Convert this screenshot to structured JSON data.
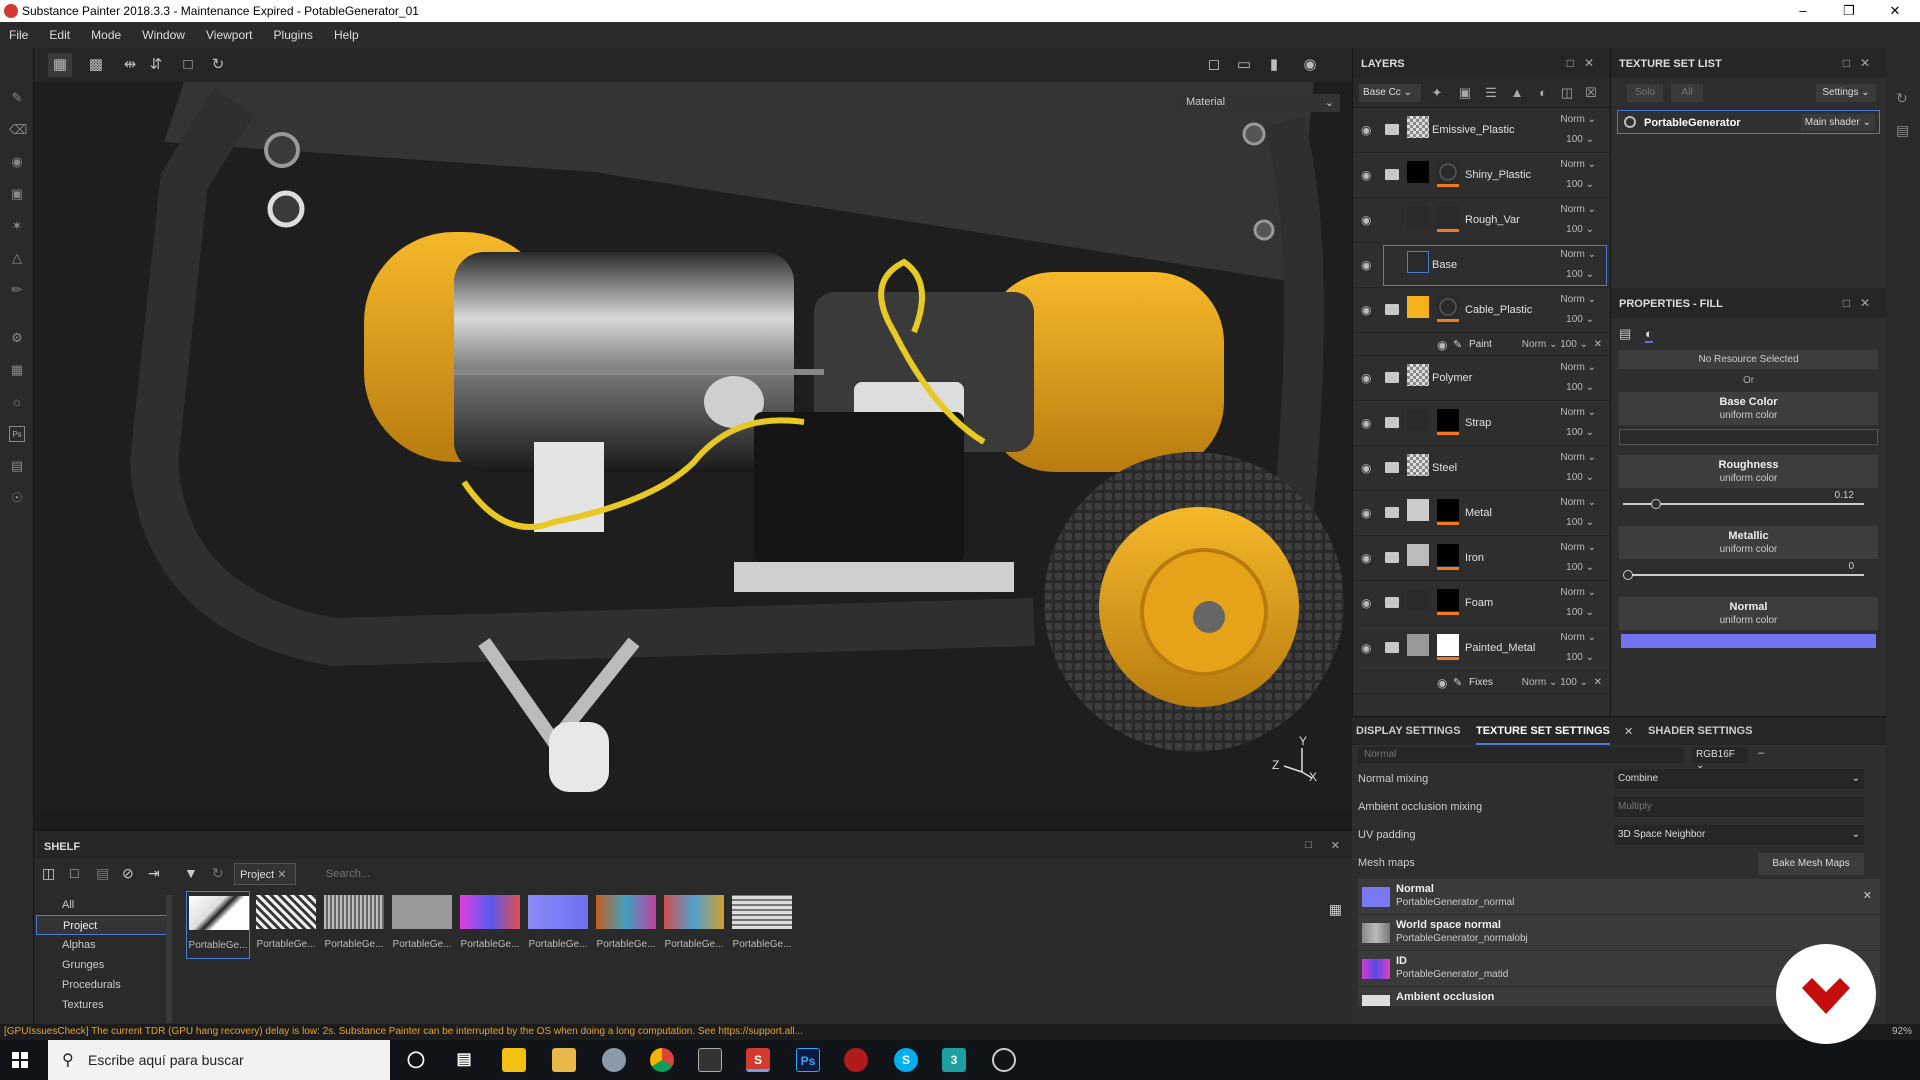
{
  "window": {
    "title": "Substance Painter 2018.3.3 - Maintenance Expired - PotableGenerator_01"
  },
  "menu": [
    "File",
    "Edit",
    "Mode",
    "Window",
    "Viewport",
    "Plugins",
    "Help"
  ],
  "viewport": {
    "material_label": "Material",
    "axes": {
      "y": "Y",
      "z": "Z",
      "x": "X"
    }
  },
  "layers": {
    "title": "LAYERS",
    "channel": "Base Cc",
    "items": [
      {
        "name": "Emissive_Plastic",
        "blend": "Norm",
        "opacity": "100"
      },
      {
        "name": "Shiny_Plastic",
        "blend": "Norm",
        "opacity": "100"
      },
      {
        "name": "Rough_Var",
        "blend": "Norm",
        "opacity": "100"
      },
      {
        "name": "Base",
        "blend": "Norm",
        "opacity": "100"
      },
      {
        "name": "Cable_Plastic",
        "blend": "Norm",
        "opacity": "100"
      },
      {
        "name": "Polymer",
        "blend": "Norm",
        "opacity": "100"
      },
      {
        "name": "Strap",
        "blend": "Norm",
        "opacity": "100"
      },
      {
        "name": "Steel",
        "blend": "Norm",
        "opacity": "100"
      },
      {
        "name": "Metal",
        "blend": "Norm",
        "opacity": "100"
      },
      {
        "name": "Iron",
        "blend": "Norm",
        "opacity": "100"
      },
      {
        "name": "Foam",
        "blend": "Norm",
        "opacity": "100"
      },
      {
        "name": "Painted_Metal",
        "blend": "Norm",
        "opacity": "100"
      }
    ],
    "sub_paint": {
      "name": "Paint",
      "blend": "Norm",
      "opacity": "100"
    },
    "sub_fixes": {
      "name": "Fixes",
      "blend": "Norm",
      "opacity": "100"
    }
  },
  "texture_set_list": {
    "title": "TEXTURE SET LIST",
    "solo": "Solo",
    "all": "All",
    "settings": "Settings",
    "set_name": "PortableGenerator",
    "shader": "Main shader"
  },
  "properties": {
    "title": "PROPERTIES - FILL",
    "no_resource": "No Resource Selected",
    "or": "Or",
    "base_color": {
      "label": "Base Color",
      "sub": "uniform color"
    },
    "roughness": {
      "label": "Roughness",
      "sub": "uniform color",
      "value": "0.12",
      "fraction": 0.12
    },
    "metallic": {
      "label": "Metallic",
      "sub": "uniform color",
      "value": "0",
      "fraction": 0
    },
    "normal": {
      "label": "Normal",
      "sub": "uniform color"
    }
  },
  "bottom_tabs": {
    "display": "DISPLAY SETTINGS",
    "texture_set": "TEXTURE SET SETTINGS",
    "shader": "SHADER SETTINGS"
  },
  "texture_set_settings": {
    "normal_label": "Normal",
    "format": "RGB16F",
    "normal_mixing": {
      "label": "Normal mixing",
      "value": "Combine"
    },
    "ao_mixing": {
      "label": "Ambient occlusion mixing",
      "value": "Multiply"
    },
    "uv_padding": {
      "label": "UV padding",
      "value": "3D Space Neighbor"
    },
    "mesh_maps_label": "Mesh maps",
    "bake_button": "Bake Mesh Maps",
    "mesh_maps": [
      {
        "name": "Normal",
        "file": "PortableGenerator_normal"
      },
      {
        "name": "World space normal",
        "file": "PortableGenerator_normalobj"
      },
      {
        "name": "ID",
        "file": "PortableGenerator_matid"
      },
      {
        "name": "Ambient occlusion",
        "file": ""
      }
    ]
  },
  "shelf": {
    "title": "SHELF",
    "filter_tag": "Project",
    "search_placeholder": "Search...",
    "categories": [
      "All",
      "Project",
      "Alphas",
      "Grunges",
      "Procedurals",
      "Textures"
    ],
    "items": [
      "PortableGe...",
      "PortableGe...",
      "PortableGe...",
      "PortableGe...",
      "PortableGe...",
      "PortableGe...",
      "PortableGe...",
      "PortableGe...",
      "PortableGe..."
    ]
  },
  "status": {
    "message": "[GPUIssuesCheck] The current TDR (GPU hang recovery) delay is low: 2s. Substance Painter can be interrupted by the OS when doing a long computation. See https://support.all...",
    "right": "92%"
  },
  "taskbar": {
    "search_placeholder": "Escribe aquí para buscar"
  }
}
